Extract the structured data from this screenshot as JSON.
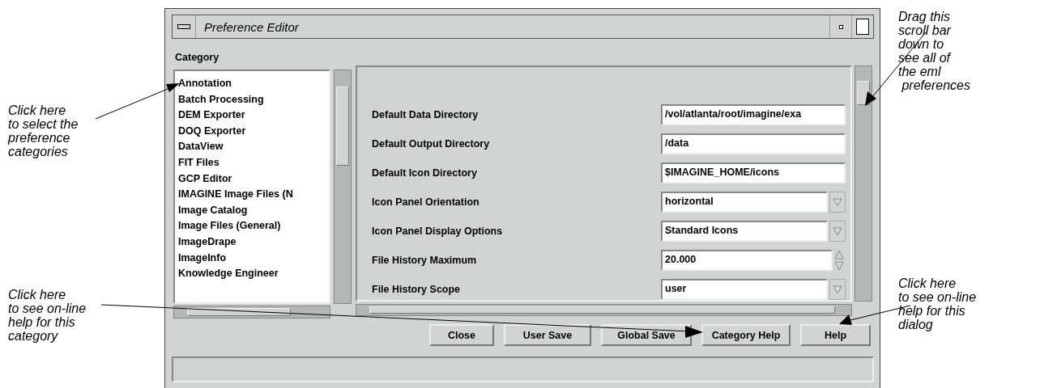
{
  "annotations": {
    "left": [
      "Click here\nto select the\npreference\ncategories",
      "Click here\nto see on-line\nhelp for this\ncategory"
    ],
    "right": [
      "Drag this\nscroll bar\ndown to\nsee all of\nthe eml\n preferences",
      "Click here\nto see on-line\nhelp for this\ndialog"
    ]
  },
  "window": {
    "title": "Preference Editor"
  },
  "category_label": "Category",
  "categories": [
    "Annotation",
    "Batch Processing",
    "DEM Exporter",
    "DOQ Exporter",
    "DataView",
    "FIT Files",
    "GCP Editor",
    "IMAGINE Image Files (N",
    "Image Catalog",
    "Image Files (General)",
    "ImageDrape",
    "ImageInfo",
    "Knowledge Engineer"
  ],
  "preferences": [
    {
      "label": "Default Data Directory",
      "kind": "text",
      "value": "/vol/atlanta/root/imagine/exa"
    },
    {
      "label": "Default Output Directory",
      "kind": "text",
      "value": "/data"
    },
    {
      "label": "Default Icon Directory",
      "kind": "text",
      "value": "$IMAGINE_HOME/icons"
    },
    {
      "label": "Icon Panel Orientation",
      "kind": "dropdown",
      "value": "horizontal"
    },
    {
      "label": "Icon Panel Display Options",
      "kind": "dropdown",
      "value": "Standard Icons"
    },
    {
      "label": "File History Maximum",
      "kind": "spin",
      "value": "20.000"
    },
    {
      "label": "File History Scope",
      "kind": "dropdown",
      "value": "user"
    }
  ],
  "buttons": [
    "Close",
    "User Save",
    "Global Save",
    "Category Help",
    "Help"
  ]
}
